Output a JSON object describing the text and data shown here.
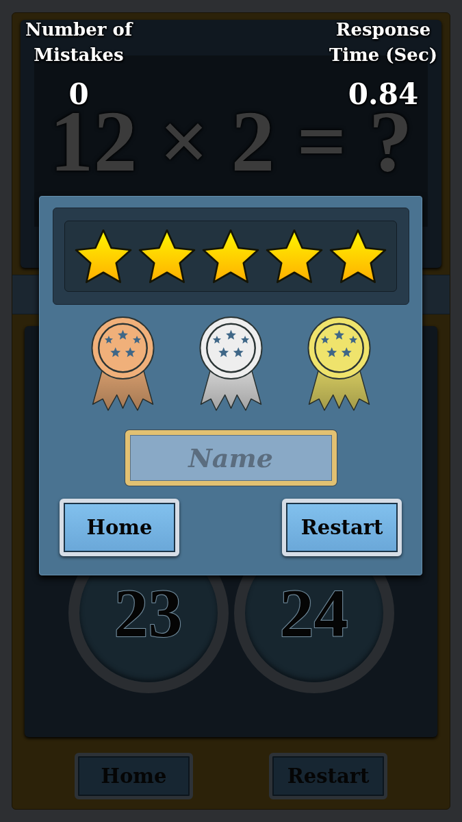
{
  "stats": [
    {
      "label": "Number of Mistakes",
      "value": "0"
    },
    {
      "label": "Response Time (Sec)",
      "value": "0.84"
    }
  ],
  "question": "12 × 2 = ?",
  "result_dialog": {
    "rating": {
      "stars": 5
    },
    "medals": [
      {
        "color": "#f0b07a"
      },
      {
        "color": "#eeeeee"
      },
      {
        "color": "#efe36c"
      }
    ],
    "name_field": {
      "placeholder": "Name"
    },
    "buttons": [
      "Home",
      "Restart"
    ]
  },
  "answers": [
    "23",
    "24"
  ],
  "footer_buttons": [
    "Home",
    "Restart"
  ]
}
